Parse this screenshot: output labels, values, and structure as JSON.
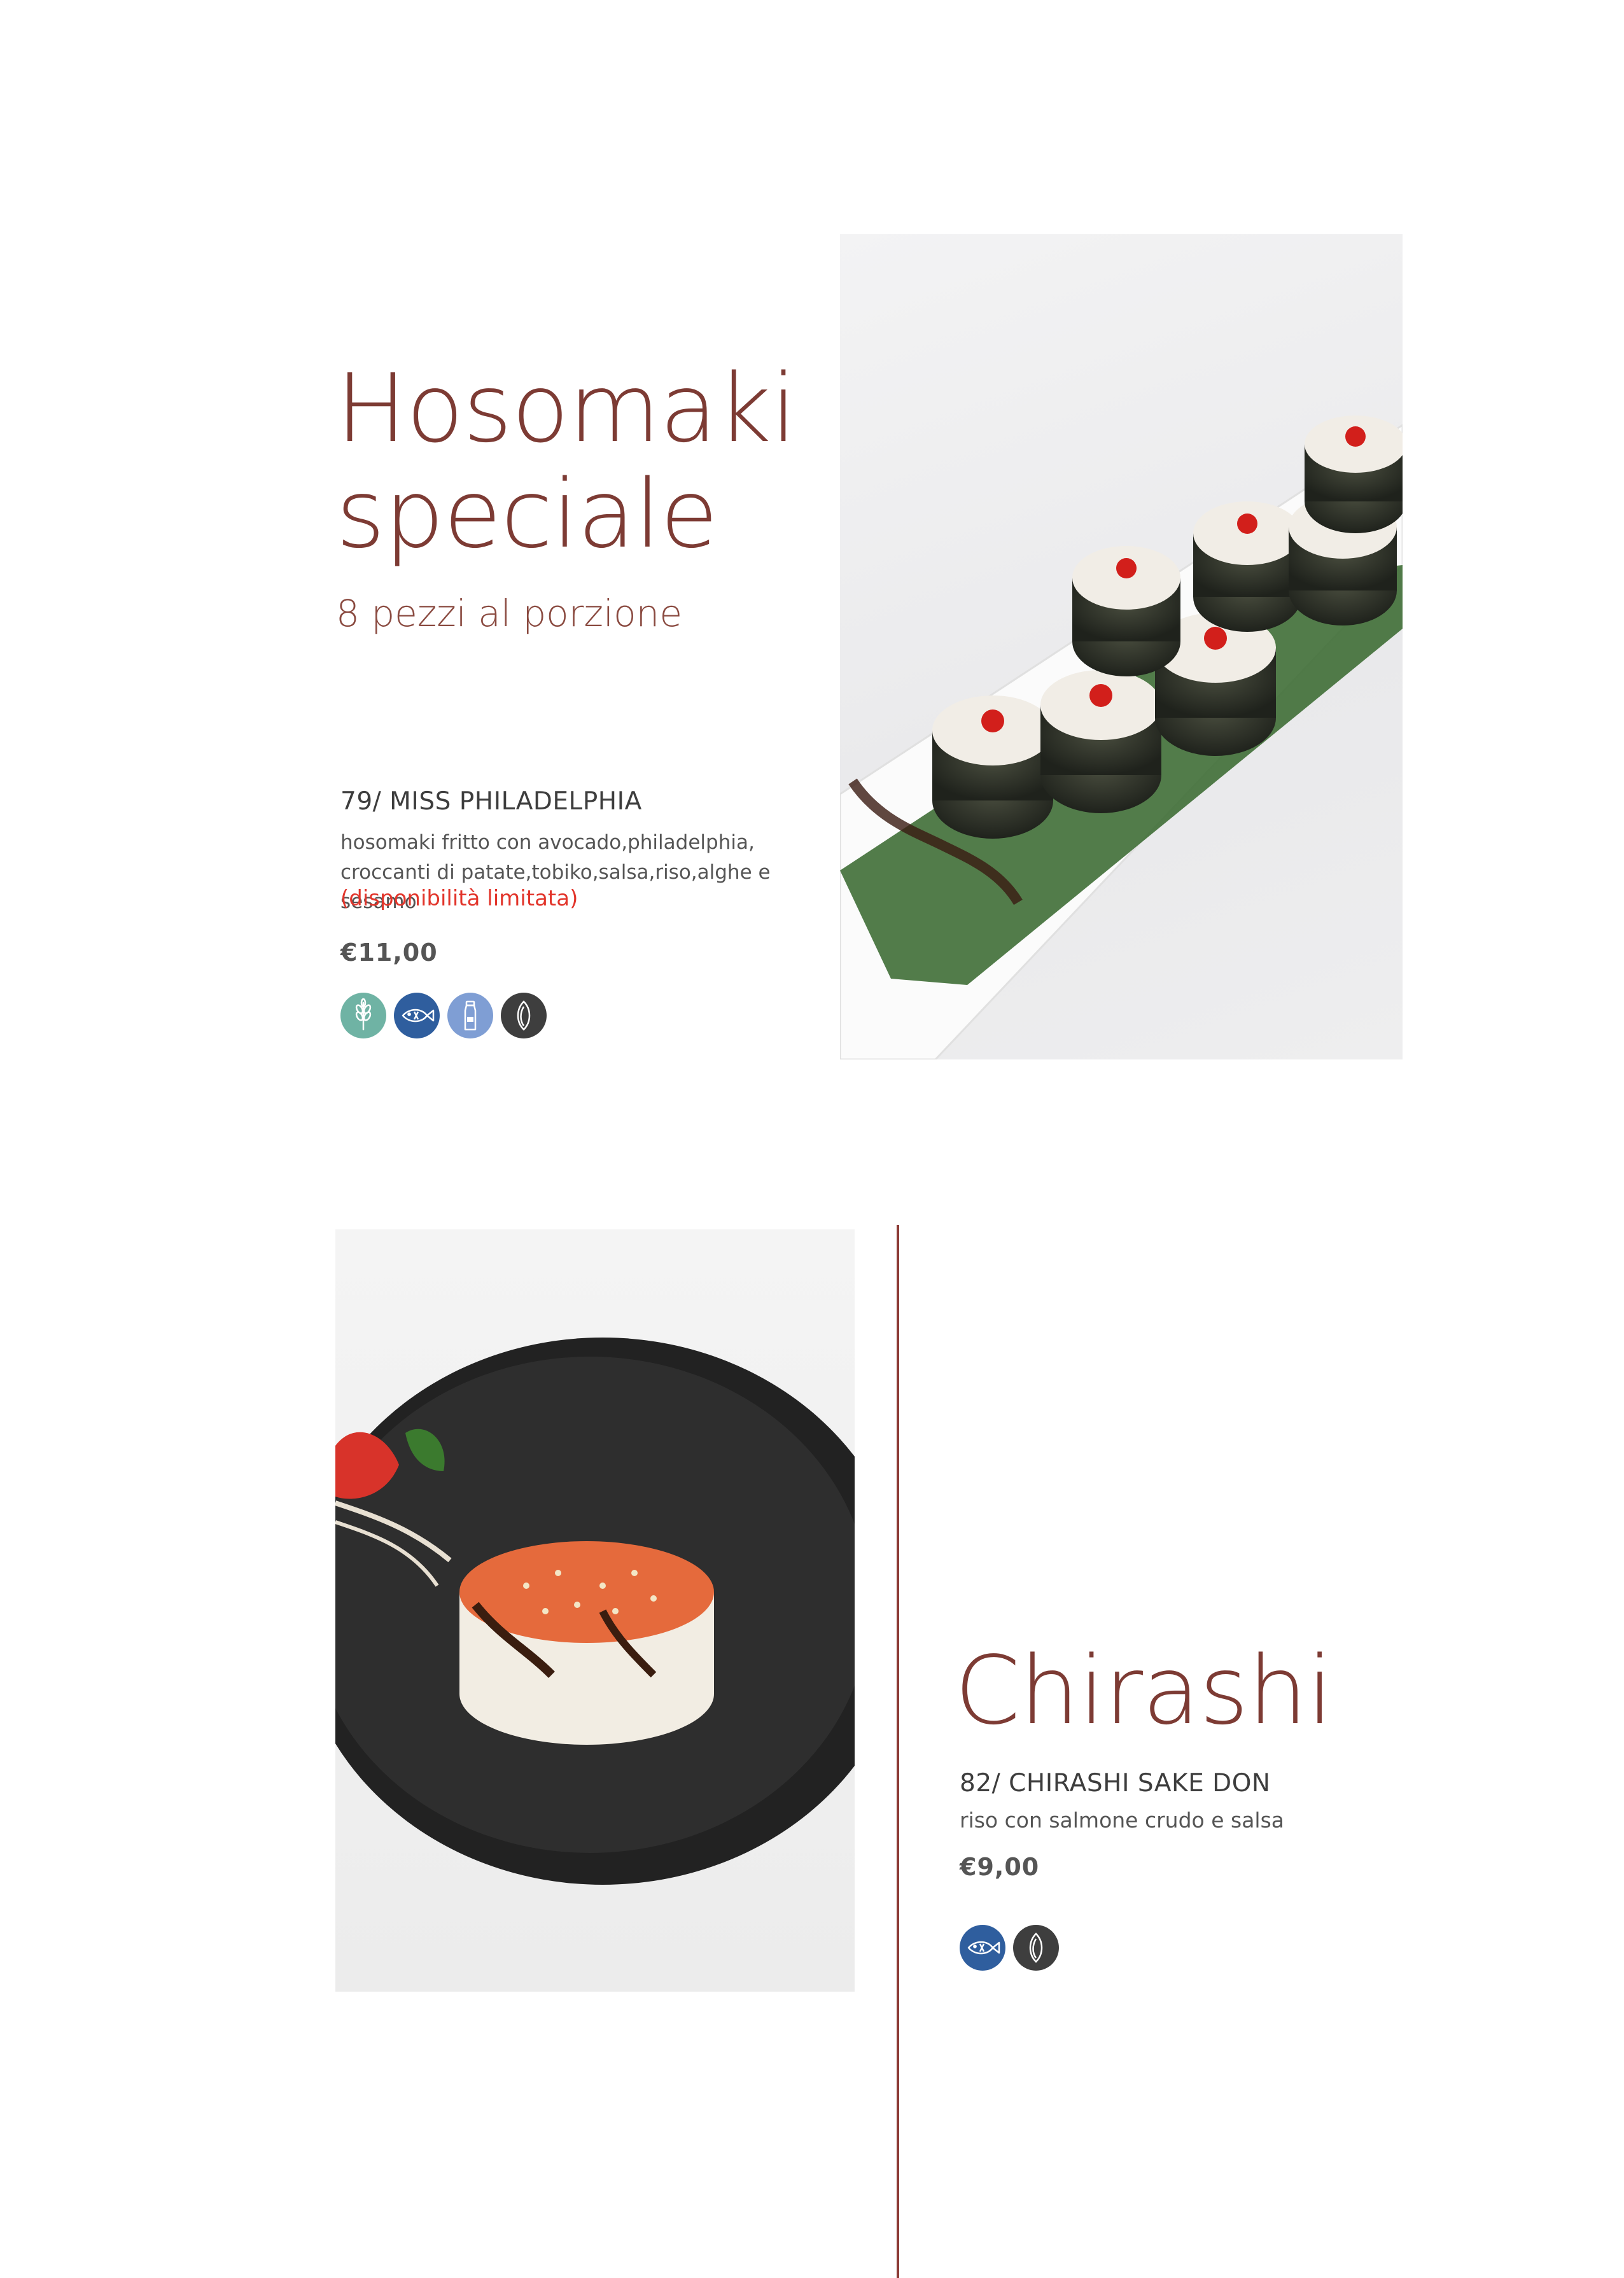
{
  "section1": {
    "title_line1": "Hosomaki",
    "title_line2": "speciale",
    "subtitle": "8 pezzi al porzione",
    "item": {
      "name": "79/ MISS PHILADELPHIA",
      "desc_line1": "hosomaki fritto con avocado,philadelphia,",
      "desc_line2": "croccanti di patate,tobiko,salsa,riso,alghe e sesamo",
      "note": "(disponibilità limitata)",
      "price": "€11,00",
      "icons": [
        "wheat-icon",
        "fish-icon",
        "milk-bottle-icon",
        "sesame-seed-icon"
      ]
    }
  },
  "section2": {
    "title": "Chirashi",
    "item": {
      "name": "82/ CHIRASHI SAKE DON",
      "desc": "riso con salmone crudo e salsa",
      "price": "€9,00",
      "icons": [
        "fish-icon",
        "sesame-seed-icon"
      ]
    }
  },
  "colors": {
    "accent": "#7d3b34",
    "divider": "#8c3b36",
    "icon_wheat": "#6fb3a4",
    "icon_fish": "#2f5e9e",
    "icon_milk": "#7f9ed4",
    "icon_sesame": "#3e3e3e"
  }
}
